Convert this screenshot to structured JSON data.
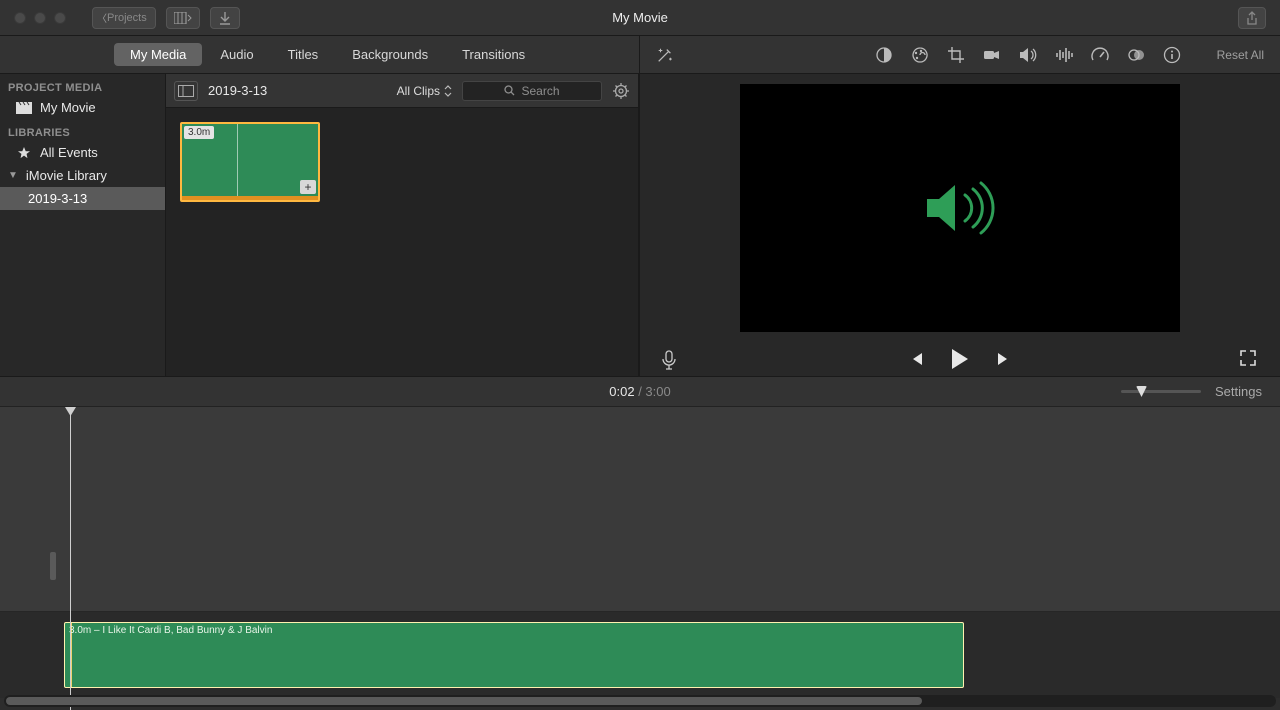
{
  "titlebar": {
    "back_label": "Projects",
    "title": "My Movie"
  },
  "tabs": {
    "my_media": "My Media",
    "audio": "Audio",
    "titles": "Titles",
    "backgrounds": "Backgrounds",
    "transitions": "Transitions"
  },
  "sidebar": {
    "project_media_header": "PROJECT MEDIA",
    "project_item": "My Movie",
    "libraries_header": "LIBRARIES",
    "all_events": "All Events",
    "imovie_library": "iMovie Library",
    "event_selected": "2019-3-13"
  },
  "browser": {
    "event_title": "2019-3-13",
    "filter_label": "All Clips",
    "search_placeholder": "Search",
    "clip_duration": "3.0m"
  },
  "preview_toolbar": {
    "reset_label": "Reset All"
  },
  "infobar": {
    "current_time": "0:02",
    "sep": " / ",
    "total_time": "3:00",
    "settings_label": "Settings"
  },
  "timeline": {
    "audio_clip_label": "3.0m – I Like It Cardi B, Bad Bunny & J Balvin"
  }
}
